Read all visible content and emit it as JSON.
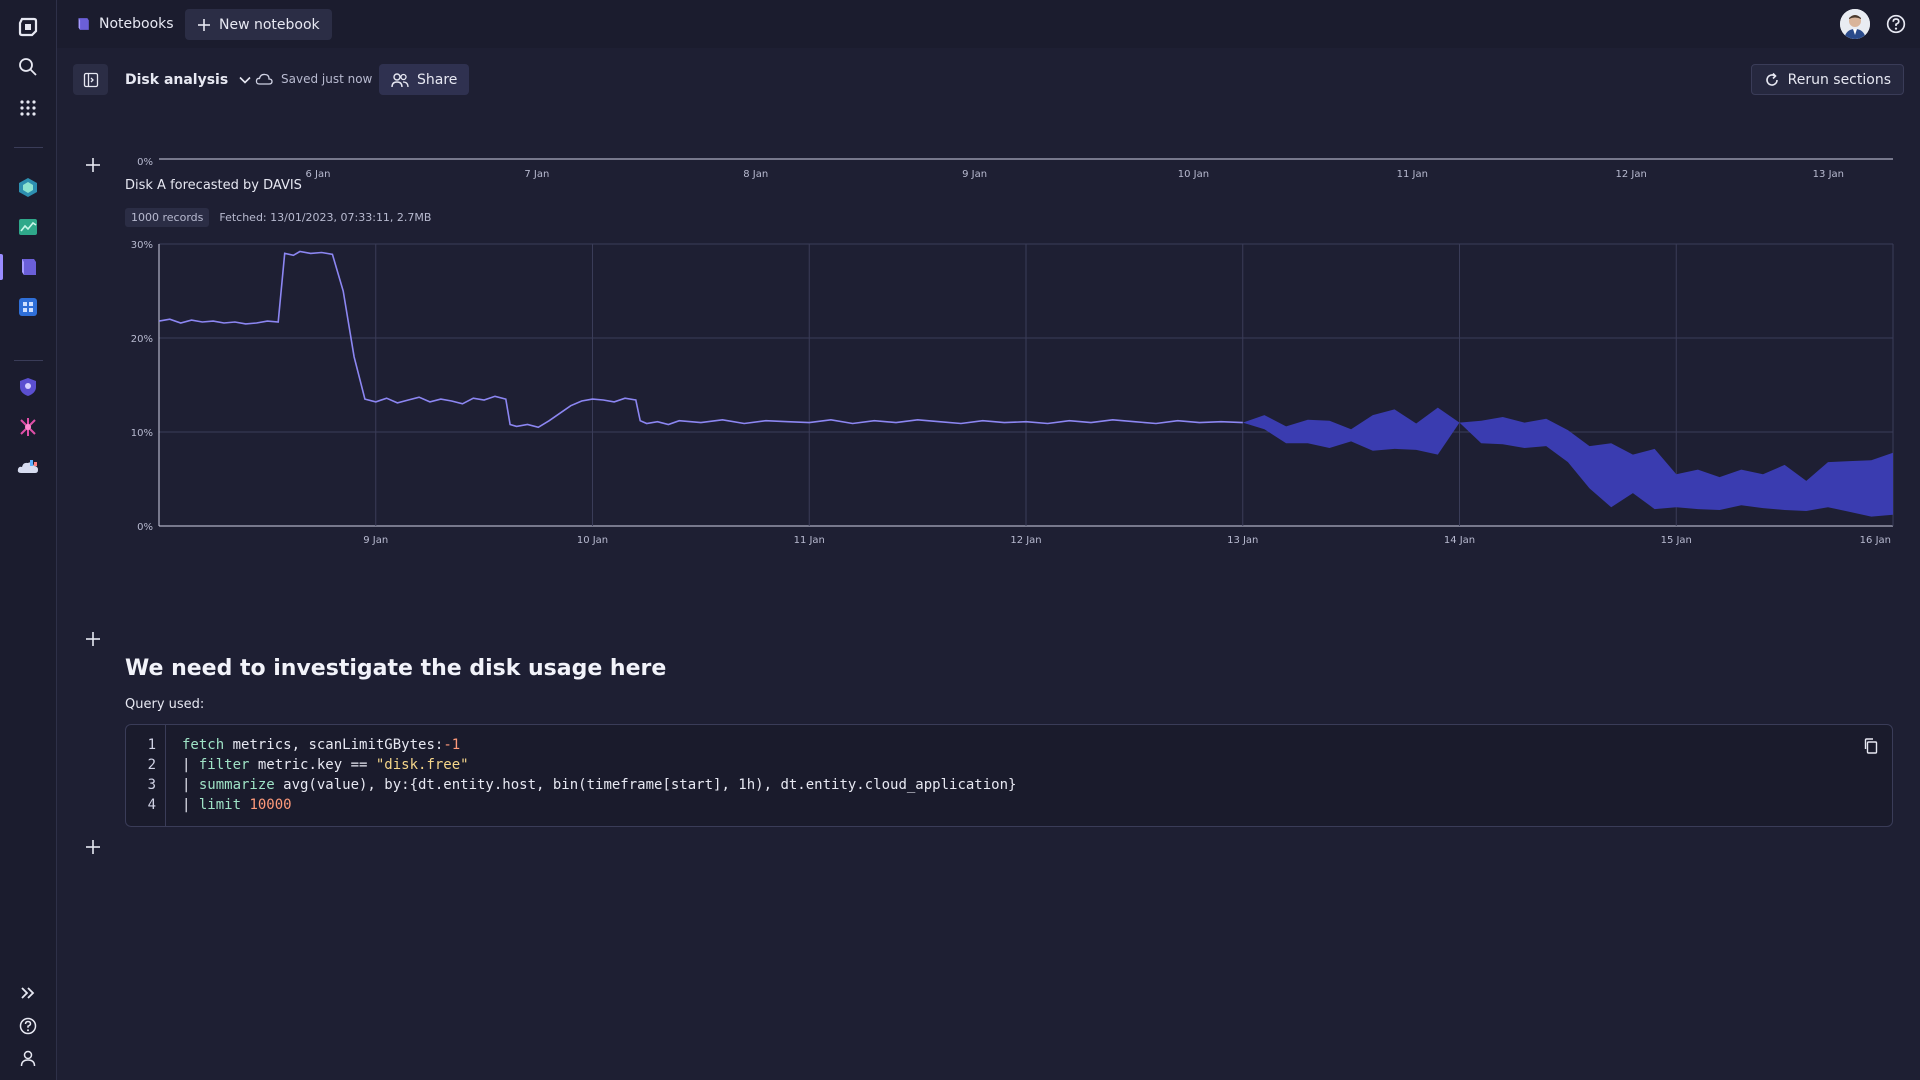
{
  "topbar": {
    "app_name": "Notebooks",
    "new_notebook_label": "New notebook"
  },
  "toolbar": {
    "notebook_title": "Disk analysis",
    "saved_status": "Saved just now",
    "share_label": "Share",
    "rerun_label": "Rerun sections"
  },
  "sidebar": {
    "items": [
      {
        "icon": "dynatrace-logo-icon"
      },
      {
        "icon": "search-icon"
      },
      {
        "icon": "apps-grid-icon"
      },
      {
        "icon": "infrastructure-app-icon"
      },
      {
        "icon": "dashboards-app-icon"
      },
      {
        "icon": "notebooks-app-icon",
        "active": true
      },
      {
        "icon": "extensions-app-icon"
      },
      {
        "icon": "security-app-icon"
      },
      {
        "icon": "workflows-app-icon"
      },
      {
        "icon": "cloud-app-icon"
      },
      {
        "icon": "expand-icon"
      },
      {
        "icon": "help-icon"
      },
      {
        "icon": "user-icon"
      }
    ]
  },
  "top_chart": {
    "y_tick": "0%",
    "x_ticks": [
      "6 Jan",
      "7 Jan",
      "8 Jan",
      "9 Jan",
      "10 Jan",
      "11 Jan",
      "12 Jan",
      "13 Jan"
    ]
  },
  "chart_section": {
    "title": "Disk A forecasted by DAVIS",
    "records_badge": "1000 records",
    "fetched_info": "Fetched: 13/01/2023, 07:33:11, 2.7MB"
  },
  "chart_data": {
    "type": "line",
    "title": "Disk A forecasted by DAVIS",
    "y_ticks": [
      "0%",
      "10%",
      "20%",
      "30%"
    ],
    "ylim": [
      0,
      30
    ],
    "x_ticks": [
      "9 Jan",
      "10 Jan",
      "11 Jan",
      "12 Jan",
      "13 Jan",
      "14 Jan",
      "15 Jan",
      "16 Jan"
    ],
    "x_start": 8.0,
    "x_end": 16.0,
    "grid": true,
    "series": [
      {
        "kind": "line",
        "color": "#8c86f2",
        "x": [
          8.0,
          8.05,
          8.1,
          8.15,
          8.2,
          8.25,
          8.3,
          8.35,
          8.4,
          8.45,
          8.5,
          8.55,
          8.58,
          8.62,
          8.65,
          8.7,
          8.75,
          8.8,
          8.85,
          8.9,
          8.95,
          9.0,
          9.05,
          9.1,
          9.15,
          9.2,
          9.25,
          9.3,
          9.35,
          9.4,
          9.45,
          9.5,
          9.55,
          9.6,
          9.62,
          9.65,
          9.7,
          9.75,
          9.8,
          9.85,
          9.9,
          9.95,
          10.0,
          10.05,
          10.1,
          10.15,
          10.2,
          10.22,
          10.25,
          10.3,
          10.35,
          10.4,
          10.5,
          10.6,
          10.7,
          10.8,
          10.9,
          11.0,
          11.1,
          11.2,
          11.3,
          11.4,
          11.5,
          11.6,
          11.7,
          11.8,
          11.9,
          12.0,
          12.1,
          12.2,
          12.3,
          12.4,
          12.5,
          12.6,
          12.7,
          12.8,
          12.9,
          13.0
        ],
        "y": [
          21.8,
          22.0,
          21.6,
          21.9,
          21.7,
          21.8,
          21.6,
          21.7,
          21.5,
          21.6,
          21.8,
          21.7,
          29.0,
          28.8,
          29.2,
          29.0,
          29.1,
          28.9,
          25.0,
          18.0,
          13.5,
          13.2,
          13.6,
          13.1,
          13.4,
          13.7,
          13.2,
          13.5,
          13.3,
          13.0,
          13.6,
          13.4,
          13.8,
          13.5,
          10.8,
          10.6,
          10.8,
          10.5,
          11.2,
          12.0,
          12.8,
          13.3,
          13.5,
          13.4,
          13.2,
          13.6,
          13.4,
          11.2,
          10.9,
          11.1,
          10.8,
          11.2,
          11.0,
          11.3,
          10.9,
          11.2,
          11.1,
          11.0,
          11.3,
          10.9,
          11.2,
          11.0,
          11.3,
          11.1,
          10.9,
          11.2,
          11.0,
          11.1,
          10.9,
          11.2,
          11.0,
          11.3,
          11.1,
          10.9,
          11.2,
          11.0,
          11.1,
          11.0
        ]
      },
      {
        "kind": "band",
        "color": "#3a3cb0",
        "x": [
          13.0,
          13.1,
          13.2,
          13.3,
          13.4,
          13.5,
          13.6,
          13.7,
          13.8,
          13.9,
          14.0,
          14.1,
          14.2,
          14.3,
          14.4,
          14.5,
          14.6,
          14.7,
          14.8,
          14.9,
          15.0,
          15.1,
          15.2,
          15.3,
          15.4,
          15.5,
          15.6,
          15.7,
          15.8,
          15.9,
          16.0
        ],
        "upper": [
          11.0,
          11.8,
          10.6,
          11.3,
          11.2,
          10.3,
          11.8,
          12.4,
          10.9,
          12.6,
          11.0,
          11.2,
          11.6,
          11.0,
          11.4,
          10.2,
          8.5,
          8.8,
          7.6,
          8.2,
          5.5,
          6.0,
          5.2,
          6.0,
          5.5,
          6.5,
          4.8,
          6.8,
          6.9,
          7.0,
          7.8
        ],
        "lower": [
          11.0,
          10.3,
          8.8,
          8.8,
          8.3,
          9.0,
          8.0,
          8.2,
          8.1,
          7.6,
          11.0,
          8.8,
          8.7,
          8.3,
          8.5,
          6.8,
          4.0,
          2.0,
          3.5,
          1.8,
          2.0,
          1.8,
          1.7,
          2.2,
          1.9,
          1.7,
          1.6,
          2.0,
          1.5,
          1.0,
          1.2
        ]
      }
    ]
  },
  "markdown_section": {
    "heading": "We need to investigate the disk usage here",
    "query_label": "Query used:"
  },
  "code": {
    "line_numbers": [
      "1",
      "2",
      "3",
      "4"
    ],
    "lines": [
      [
        {
          "t": "fetch",
          "c": "kw"
        },
        {
          "t": " metrics, scanLimitGBytes:",
          "c": ""
        },
        {
          "t": "-1",
          "c": "num"
        }
      ],
      [
        {
          "t": "| ",
          "c": ""
        },
        {
          "t": "filter",
          "c": "kw"
        },
        {
          "t": " metric.key == ",
          "c": ""
        },
        {
          "t": "\"disk.free\"",
          "c": "str"
        }
      ],
      [
        {
          "t": "| ",
          "c": ""
        },
        {
          "t": "summarize",
          "c": "kw"
        },
        {
          "t": " avg(value), by:{dt.entity.host, bin(timeframe[start], 1h), dt.entity.cloud_application}",
          "c": ""
        }
      ],
      [
        {
          "t": "| ",
          "c": ""
        },
        {
          "t": "limit",
          "c": "kw"
        },
        {
          "t": " ",
          "c": ""
        },
        {
          "t": "10000",
          "c": "num"
        }
      ]
    ]
  }
}
